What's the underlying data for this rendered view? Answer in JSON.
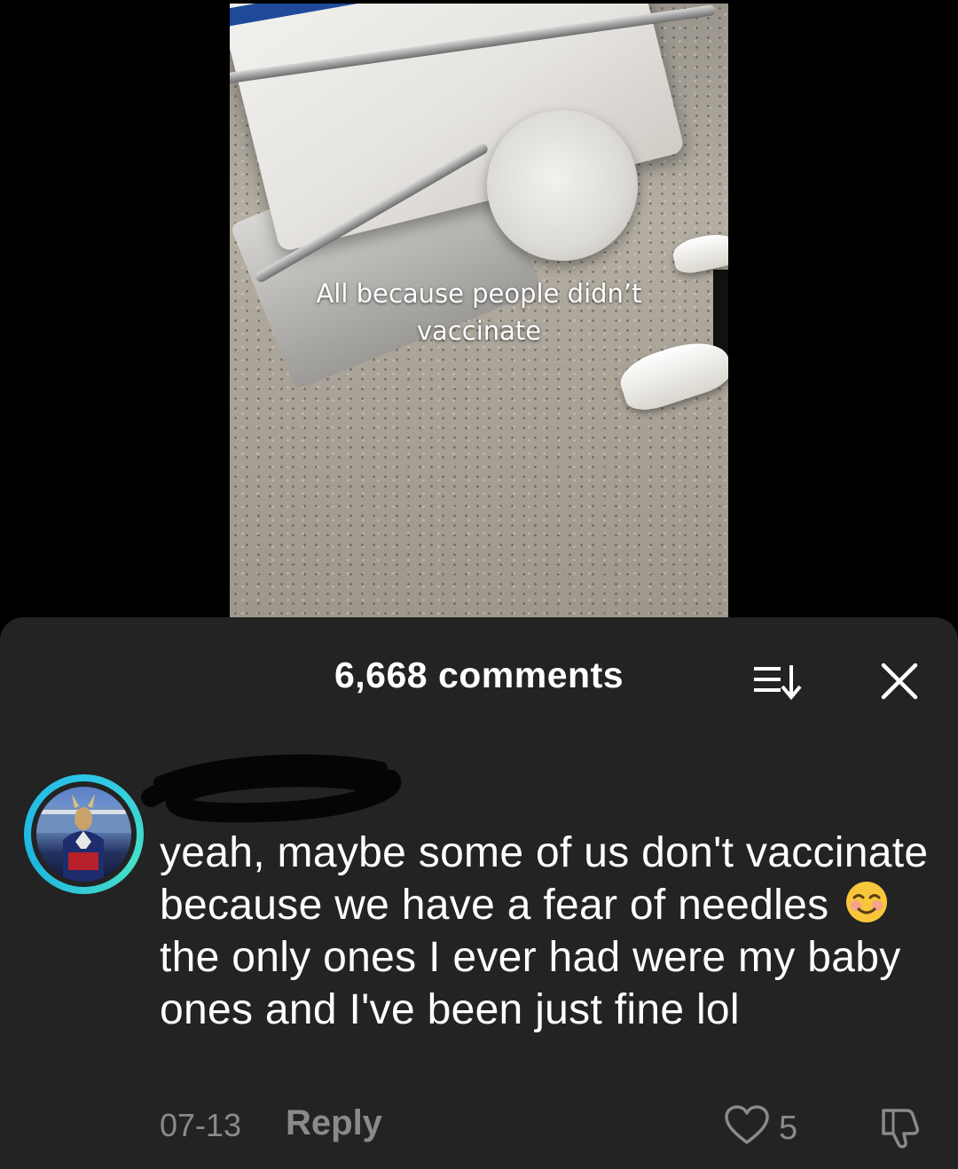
{
  "video": {
    "caption_line1": "All because people didn’t",
    "caption_line2": "vaccinate"
  },
  "comments_sheet": {
    "title": "6,668 comments",
    "sort_icon": "sort-icon",
    "close_icon": "close-icon"
  },
  "comment": {
    "avatar_icon": "avatar",
    "text_part1": "yeah, maybe some of us don't vaccinate because we have a fear of needles",
    "emoji": "☺",
    "text_part2": "the only ones I ever had were my baby ones and I've been just fine lol",
    "date": "07-13",
    "reply_label": "Reply",
    "like_count": "5"
  },
  "colors": {
    "sheet_background": "#232323",
    "muted_text": "#8a8a8a",
    "avatar_ring": "#2bc5e8"
  }
}
